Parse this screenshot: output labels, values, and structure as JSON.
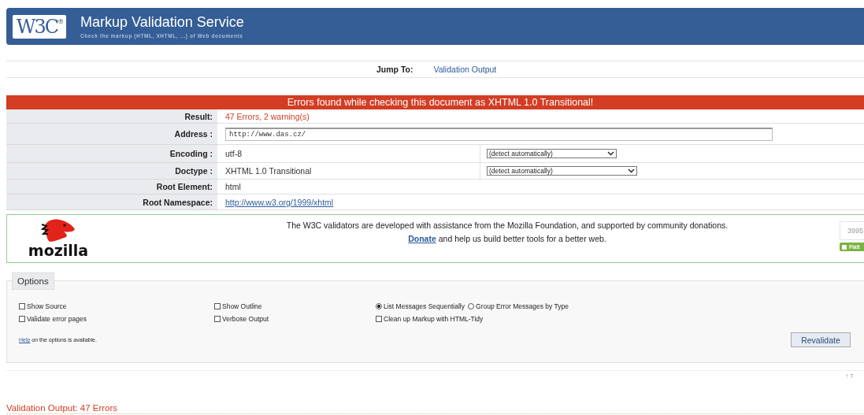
{
  "header": {
    "logo": "W3C",
    "logo_mark": "®",
    "title": "Markup Validation Service",
    "subtitle": "Check the markup (HTML, XHTML, ...) of Web documents"
  },
  "jump": {
    "label": "Jump To:",
    "link": "Validation Output"
  },
  "banner": "Errors found while checking this document as XHTML 1.0 Transitional!",
  "rows": [
    {
      "kind": "result",
      "label": "Result:",
      "value": "47 Errors, 2 warning(s)"
    },
    {
      "kind": "input",
      "label": "Address :",
      "value": "http://www.das.cz/"
    },
    {
      "kind": "select",
      "label": "Encoding :",
      "value": "utf-8",
      "option": "(detect automatically)"
    },
    {
      "kind": "select",
      "label": "Doctype :",
      "value": "XHTML 1.0 Transitional",
      "option": "(detect automatically)"
    },
    {
      "kind": "text",
      "label": "Root Element:",
      "value": "html"
    },
    {
      "kind": "link",
      "label": "Root Namespace:",
      "value": "http://www.w3.org/1999/xhtml"
    }
  ],
  "sponsor": {
    "logo": "mozilla",
    "text": "The W3C validators are developed with assistance from the Mozilla Foundation, and supported by community donations.",
    "donate": "Donate",
    "donate_rest": "and help us build better tools for a better web.",
    "count": "3995",
    "flattr": "Flatt"
  },
  "options": {
    "legend": "Options",
    "items": [
      {
        "kind": "checkbox",
        "label": "Show Source",
        "checked": false
      },
      {
        "kind": "checkbox",
        "label": "Show Outline",
        "checked": false
      },
      {
        "kind": "radio",
        "label": "List Messages Sequentially",
        "selected": true
      },
      {
        "kind": "radio",
        "label": "Group Error Messages by Type",
        "selected": false
      },
      {
        "kind": "checkbox",
        "label": "Validate error pages",
        "checked": false
      },
      {
        "kind": "checkbox",
        "label": "Verbose Output",
        "checked": false
      },
      {
        "kind": "checkbox",
        "label": "Clean up Markup with HTML-Tidy",
        "checked": false
      }
    ],
    "help_link": "Help",
    "help_rest": "on the options is available.",
    "button": "Revalidate"
  },
  "top_link": "↑ T",
  "output_heading": "Validation Output: 47 Errors"
}
